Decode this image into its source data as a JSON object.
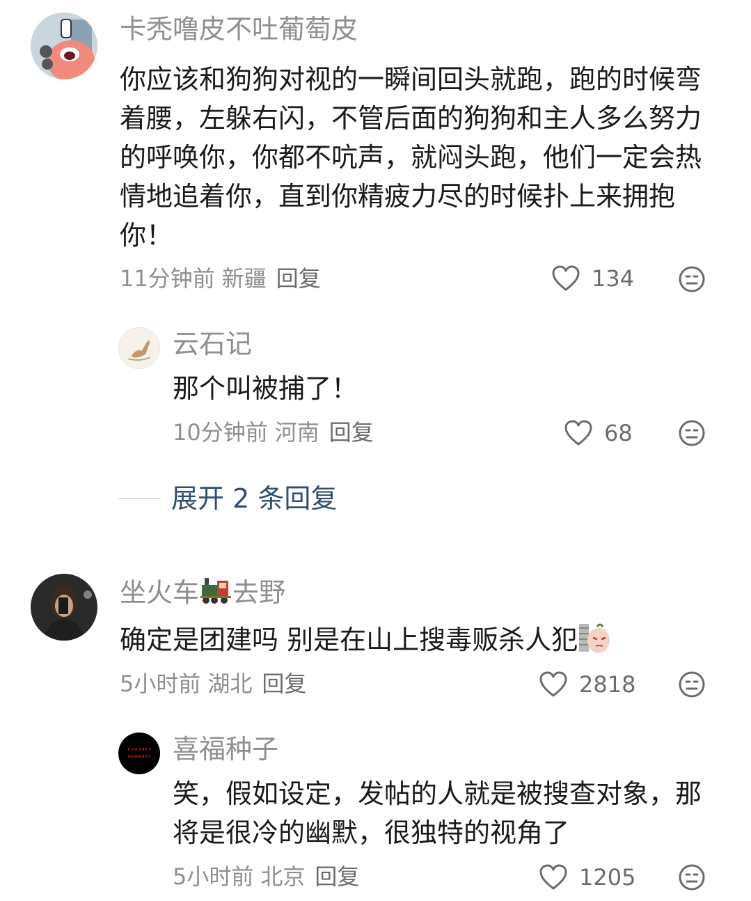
{
  "comments": [
    {
      "user": "卡秃噜皮不吐葡萄皮",
      "text": "你应该和狗狗对视的一瞬间回头就跑，跑的时候弯着腰，左躲右闪，不管后面的狗狗和主人多么努力的呼唤你，你都不吭声，就闷头跑，他们一定会热情地追着你，直到你精疲力尽的时候扑上来拥抱你！",
      "time": "11分钟前",
      "location": "新疆",
      "reply_label": "回复",
      "likes": "134"
    },
    {
      "user": "云石记",
      "text": "那个叫被捕了！",
      "time": "10分钟前",
      "location": "河南",
      "reply_label": "回复",
      "likes": "68"
    },
    {
      "user_prefix": "坐火车",
      "user_suffix": "去野",
      "text": "确定是团建吗 别是在山上搜毒贩杀人犯",
      "time": "5小时前",
      "location": "湖北",
      "reply_label": "回复",
      "likes": "2818"
    },
    {
      "user": "喜福种子",
      "text": "笑，假如设定，发帖的人就是被搜查对象，那将是很冷的幽默，很独特的视角了",
      "time": "5小时前",
      "location": "北京",
      "reply_label": "回复",
      "likes": "1205"
    }
  ],
  "expand_replies": "展开 2 条回复",
  "icons": {
    "like": "heart-outline-icon",
    "dislike": "meh-face-icon",
    "train": "train-emoji",
    "meme": "meme-emoji"
  },
  "colors": {
    "name": "#8f8f8f",
    "text": "#1a1a1a",
    "link": "#2f4e72",
    "icon": "#6b6b6b"
  }
}
